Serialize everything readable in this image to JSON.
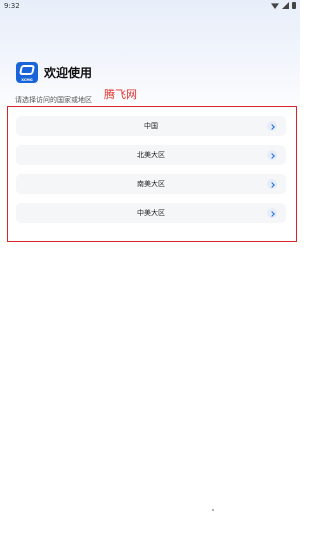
{
  "status_bar": {
    "time": "9:32"
  },
  "header": {
    "logo_text": "XCMG",
    "title": "欢迎使用"
  },
  "subtitle": "请选择访问的国家或地区",
  "watermark": "腾飞网",
  "regions": [
    {
      "label": "中国"
    },
    {
      "label": "北美大区"
    },
    {
      "label": "南美大区"
    },
    {
      "label": "中美大区"
    }
  ],
  "colors": {
    "brand": "#1864d8",
    "highlight_border": "#d9252a",
    "chevron": "#1f6ee6",
    "item_bg": "#f5f6f8"
  },
  "icons": {
    "logo": "xcmg-logo-icon",
    "chevron": "chevron-right-icon",
    "wifi": "wifi-icon",
    "signal": "signal-icon",
    "battery": "battery-icon"
  }
}
